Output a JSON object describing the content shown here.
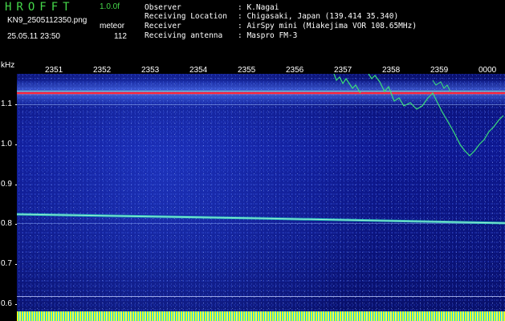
{
  "header": {
    "logo": "HROFFT",
    "version": "1.0.0f",
    "filename": "KN9_2505112350.png",
    "meteor_label": "meteor",
    "datetime": "25.05.11 23:50",
    "meteor_count": "112"
  },
  "info": [
    {
      "label": "Observer",
      "value": ": K.Nagai"
    },
    {
      "label": "Receiving Location",
      "value": ": Chigasaki, Japan (139.414 35.340)"
    },
    {
      "label": "Receiver",
      "value": ": AirSpy mini (Miakejima VOR 108.65MHz)"
    },
    {
      "label": "Receiving antenna",
      "value": ": Maspro FM-3"
    }
  ],
  "spectrogram": {
    "y_unit": "kHz",
    "y_ticks": [
      "1.1",
      "1.0",
      "0.9",
      "0.8",
      "0.7",
      "0.6"
    ],
    "x_ticks": [
      "2351",
      "2352",
      "2353",
      "2354",
      "2355",
      "2356",
      "2357",
      "2358",
      "2359",
      "0000"
    ],
    "colors": {
      "background": "#0b1480",
      "carrier_line": "#ff2a3a",
      "trace": "#3be07a",
      "text_green": "#45d84a"
    }
  }
}
